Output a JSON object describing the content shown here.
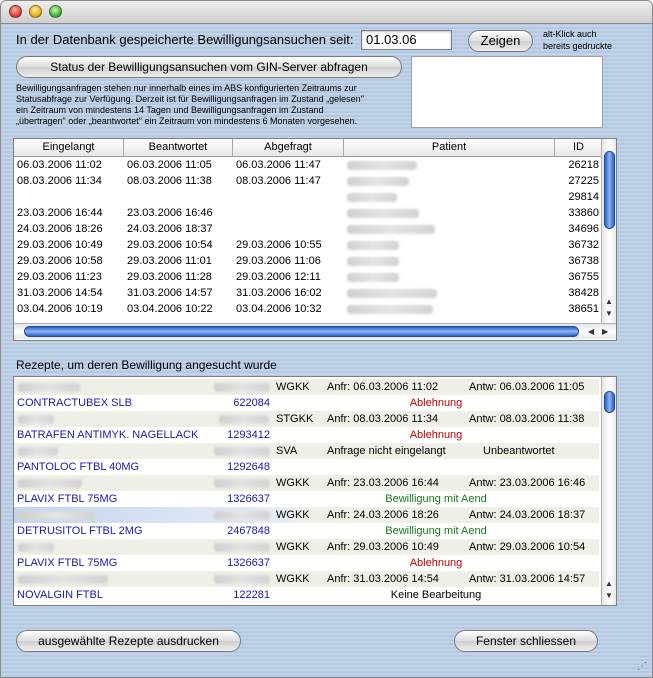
{
  "header": {
    "since_label": "In der Datenbank gespeicherte Bewilligungsansuchen seit:",
    "date_value": "01.03.06",
    "show_button": "Zeigen",
    "altclick_note_line1": "alt-Klick auch",
    "altclick_note_line2": "bereits gedruckte",
    "status_button": "Status der Bewilligungsansuchen vom GIN-Server abfragen",
    "info_line1": "Bewilligungsanfragen stehen nur innerhalb eines im ABS konfigurierten Zeitraums zur",
    "info_line2": "Statusabfrage zur Verfügung. Derzeit ist für Bewilligungsanfragen im Zustand „gelesen\"",
    "info_line3": "ein Zeitraum von mindestens 14 Tagen und Bewilligungsanfragen im Zustand",
    "info_line4": "„übertragen\" oder „beantwortet\" ein Zeitraum von mindestens 6 Monaten vorgesehen."
  },
  "requests_table": {
    "columns": [
      "Eingelangt",
      "Beantwortet",
      "Abgefragt",
      "Patient",
      "ID"
    ],
    "rows": [
      {
        "eingelangt": "06.03.2006 11:02",
        "beantwortet": "06.03.2006 11:05",
        "abgefragt": "06.03.2006 11:47",
        "id": "26218"
      },
      {
        "eingelangt": "08.03.2006 11:34",
        "beantwortet": "08.03.2006 11:38",
        "abgefragt": "08.03.2006 11:47",
        "id": "27225"
      },
      {
        "eingelangt": "",
        "beantwortet": "",
        "abgefragt": "",
        "id": "29814"
      },
      {
        "eingelangt": "23.03.2006 16:44",
        "beantwortet": "23.03.2006 16:46",
        "abgefragt": "",
        "id": "33860"
      },
      {
        "eingelangt": "24.03.2006 18:26",
        "beantwortet": "24.03.2006 18:37",
        "abgefragt": "",
        "id": "34696"
      },
      {
        "eingelangt": "29.03.2006 10:49",
        "beantwortet": "29.03.2006 10:54",
        "abgefragt": "29.03.2006 10:55",
        "id": "36732"
      },
      {
        "eingelangt": "29.03.2006 10:58",
        "beantwortet": "29.03.2006 11:01",
        "abgefragt": "29.03.2006 11:06",
        "id": "36738"
      },
      {
        "eingelangt": "29.03.2006 11:23",
        "beantwortet": "29.03.2006 11:28",
        "abgefragt": "29.03.2006 12:11",
        "id": "36755"
      },
      {
        "eingelangt": "31.03.2006 14:54",
        "beantwortet": "31.03.2006 14:57",
        "abgefragt": "31.03.2006 16:02",
        "id": "38428"
      },
      {
        "eingelangt": "03.04.2006 10:19",
        "beantwortet": "03.04.2006 10:22",
        "abgefragt": "03.04.2006 10:32",
        "id": "38651"
      }
    ]
  },
  "rezepte": {
    "section_label": "Rezepte, um deren Bewilligung angesucht wurde",
    "entries": [
      {
        "kasse": "WGKK",
        "anfr": "Anfr: 06.03.2006 11:02",
        "antw": "Antw: 06.03.2006 11:05",
        "medikament": "CONTRACTUBEX SLB",
        "code": "622084",
        "status": "Ablehnung"
      },
      {
        "kasse": "STGKK",
        "anfr": "Anfr: 08.03.2006 11:34",
        "antw": "Antw: 08.03.2006 11:38",
        "medikament": "BATRAFEN ANTIMYK. NAGELLACK",
        "code": "1293412",
        "status": "Ablehnung"
      },
      {
        "kasse": "SVA",
        "anfr": "Anfrage nicht eingelangt",
        "antw": "Unbeantwortet",
        "medikament": "PANTOLOC FTBL 40MG",
        "code": "1292648",
        "status": ""
      },
      {
        "kasse": "WGKK",
        "anfr": "Anfr: 23.03.2006 16:44",
        "antw": "Antw: 23.03.2006 16:46",
        "medikament": "PLAVIX FTBL 75MG",
        "code": "1326637",
        "status": "Bewilligung mit Aend"
      },
      {
        "kasse": "WGKK",
        "anfr": "Anfr: 24.03.2006 18:26",
        "antw": "Antw: 24.03.2006 18:37",
        "medikament": "DETRUSITOL FTBL 2MG",
        "code": "2467848",
        "status": "Bewilligung mit Aend"
      },
      {
        "kasse": "WGKK",
        "anfr": "Anfr: 29.03.2006 10:49",
        "antw": "Antw: 29.03.2006 10:54",
        "medikament": "PLAVIX FTBL 75MG",
        "code": "1326637",
        "status": "Ablehnung"
      },
      {
        "kasse": "WGKK",
        "anfr": "Anfr: 31.03.2006 14:54",
        "antw": "Antw: 31.03.2006 14:57",
        "medikament": "NOVALGIN FTBL",
        "code": "122281",
        "status": "Keine Bearbeitung"
      }
    ]
  },
  "footer": {
    "print_button": "ausgewählte Rezepte ausdrucken",
    "close_button": "Fenster schliessen"
  },
  "colors": {
    "rejected": "#c00000",
    "approved": "#1a7a1a",
    "drug": "#1a1aaa"
  }
}
